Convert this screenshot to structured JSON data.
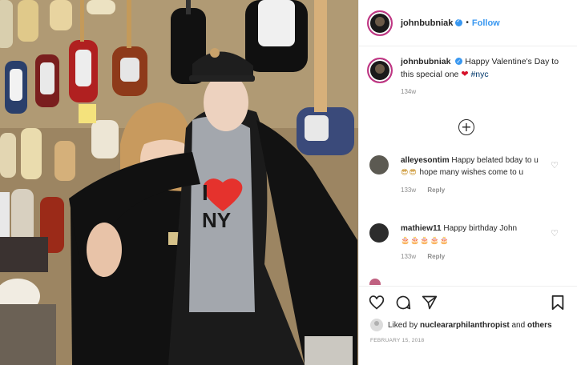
{
  "post": {
    "username": "johnbubniak",
    "follow_label": "Follow",
    "separator": "•",
    "caption_text": "Happy Valentine's Day to this special one",
    "caption_hashtag": "#nyc",
    "caption_time": "134w",
    "likes_prefix": "Liked by",
    "likes_user": "nucleararphilanthropist",
    "likes_and": "and",
    "likes_others": "others",
    "date": "FEBRUARY 15, 2018"
  },
  "photo": {
    "shirt_text": "I NY"
  },
  "comments": [
    {
      "username": "alleyesontim",
      "text": "Happy belated bday to u",
      "emoji": "😎😎",
      "text_after": "hope many wishes come to u",
      "time": "133w",
      "reply_label": "Reply"
    },
    {
      "username": "mathiew11",
      "text": "Happy birthday John",
      "emoji": "🎂🎂🎂🎂🎂",
      "time": "133w",
      "reply_label": "Reply"
    }
  ],
  "colors": {
    "accent_blue": "#3897f0",
    "heart_red": "#d6112a",
    "text_dark": "#262626",
    "text_muted": "#8e8e8e"
  },
  "icons": [
    "heart-icon",
    "comment-icon",
    "share-icon",
    "bookmark-icon",
    "add-comment-icon",
    "verified-badge-icon"
  ]
}
